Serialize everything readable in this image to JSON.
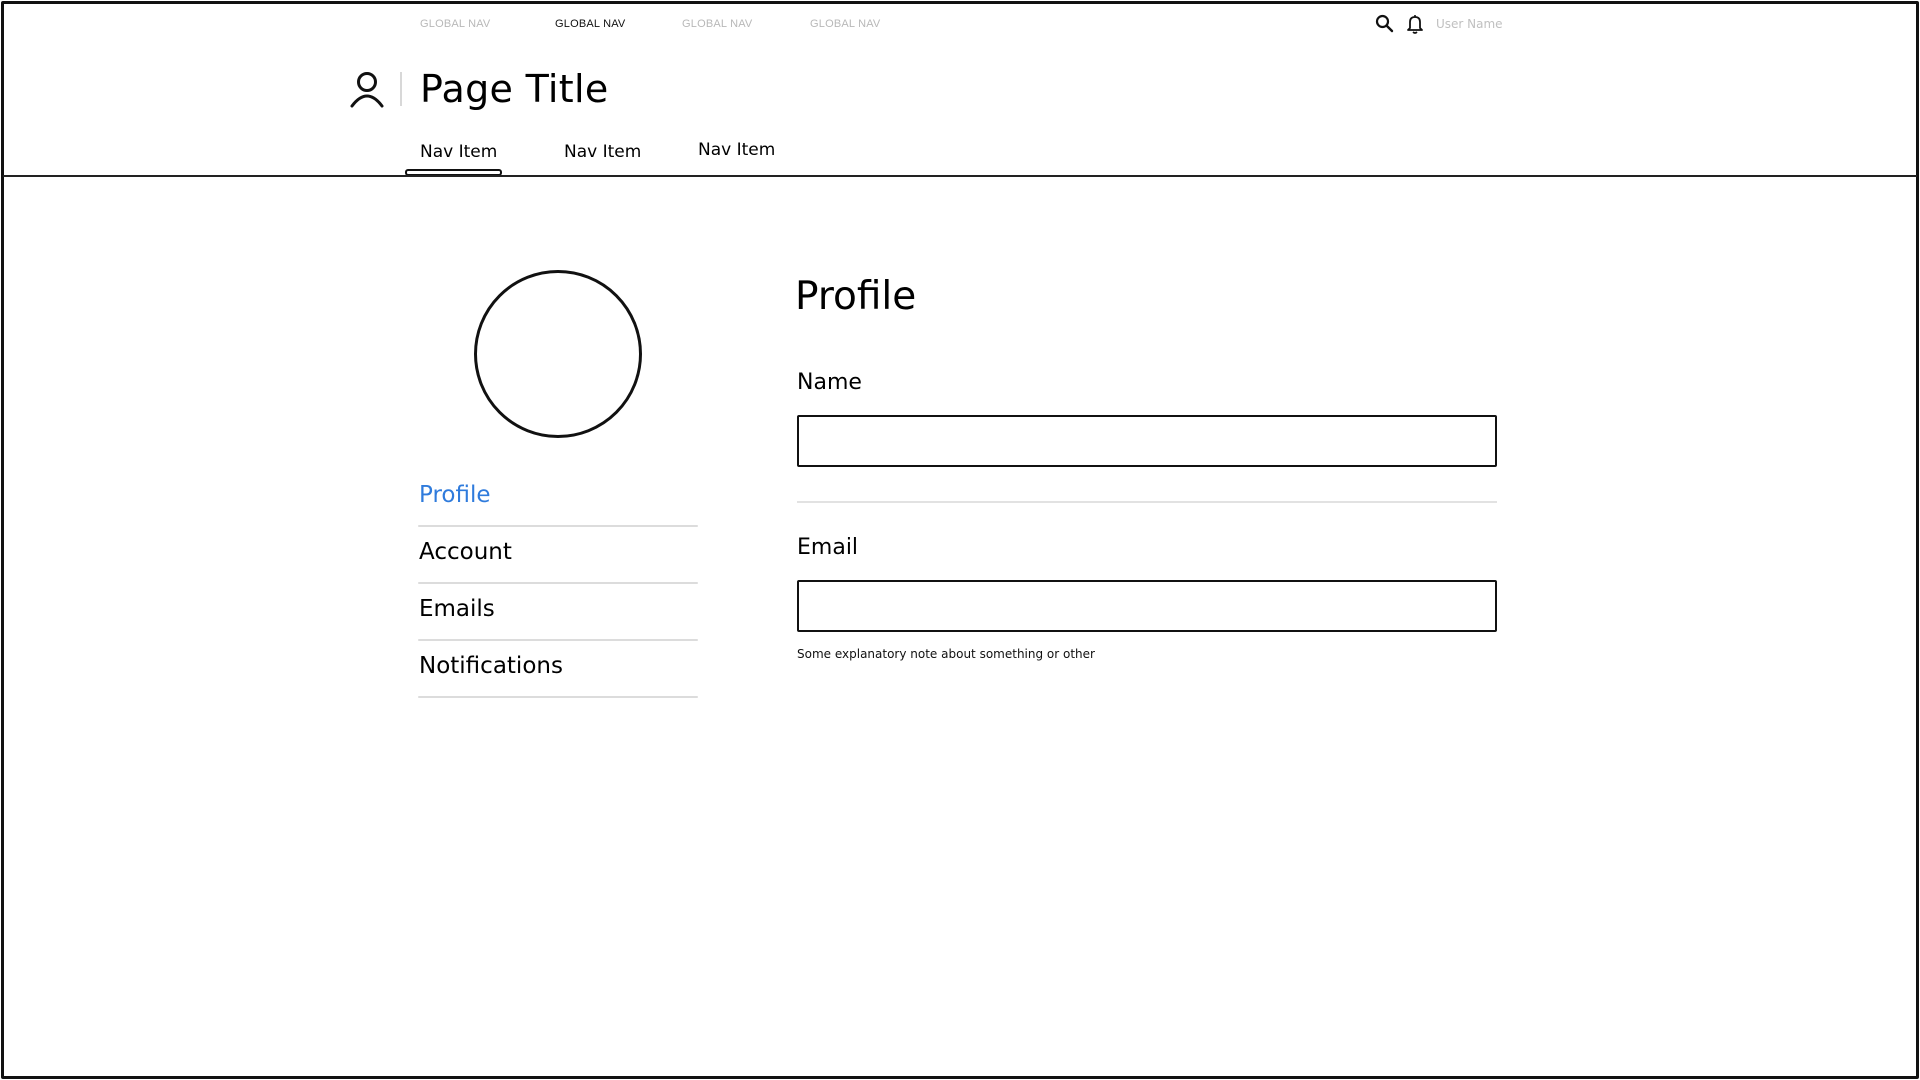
{
  "global_nav": {
    "items": [
      {
        "label": "GLOBAL NAV",
        "active": false
      },
      {
        "label": "GLOBAL NAV",
        "active": true
      },
      {
        "label": "GLOBAL NAV",
        "active": false
      },
      {
        "label": "GLOBAL NAV",
        "active": false
      }
    ],
    "icons": [
      "search-icon",
      "bell-icon"
    ],
    "user_name": "User Name"
  },
  "header": {
    "icon": "user-icon",
    "title": "Page Title"
  },
  "sub_nav": {
    "items": [
      {
        "label": "Nav Item",
        "active": true
      },
      {
        "label": "Nav Item",
        "active": false
      },
      {
        "label": "Nav Item",
        "active": false
      }
    ]
  },
  "sidebar": {
    "avatar": "avatar-placeholder",
    "items": [
      {
        "label": "Profile",
        "active": true
      },
      {
        "label": "Account",
        "active": false
      },
      {
        "label": "Emails",
        "active": false
      },
      {
        "label": "Notifications",
        "active": false
      }
    ],
    "active_color": "#2f7bdc"
  },
  "form": {
    "title": "Profile",
    "fields": [
      {
        "label": "Name",
        "value": "",
        "placeholder": ""
      },
      {
        "label": "Email",
        "value": "",
        "placeholder": "",
        "note": "Some explanatory note about something or other"
      }
    ]
  }
}
